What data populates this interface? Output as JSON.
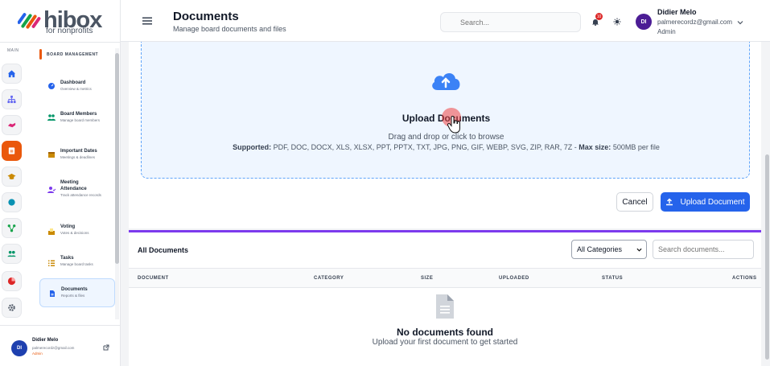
{
  "brand": {
    "name": "hibox",
    "tagline": "for nonprofits"
  },
  "rail": {
    "label": "MAIN",
    "items": [
      {
        "name": "home-icon",
        "color": "#2563eb"
      },
      {
        "name": "org-chart-icon",
        "color": "#6366f1"
      },
      {
        "name": "handshake-icon",
        "color": "#db2777"
      },
      {
        "name": "board-icon",
        "color": "#ffffff",
        "active": true
      },
      {
        "name": "graduation-cap-icon",
        "color": "#ca8a04"
      },
      {
        "name": "circle-icon",
        "color": "#0891b2"
      },
      {
        "name": "network-icon",
        "color": "#16a34a"
      },
      {
        "name": "users-icon",
        "color": "#059669"
      },
      {
        "name": "pie-chart-icon",
        "color": "#dc2626"
      },
      {
        "name": "gear-icon",
        "color": "#4b5563"
      }
    ]
  },
  "menu": {
    "header": "BOARD MANAGEMENT",
    "items": [
      {
        "title": "Dashboard",
        "sub": "Overview & metrics"
      },
      {
        "title": "Board Members",
        "sub": "Manage board members"
      },
      {
        "title": "Important Dates",
        "sub": "Meetings & deadlines"
      },
      {
        "title": "Meeting Attendance",
        "sub": "Track attendance records"
      },
      {
        "title": "Voting",
        "sub": "Votes & decisions"
      },
      {
        "title": "Tasks",
        "sub": "Manage board tasks"
      },
      {
        "title": "Documents",
        "sub": "Reports & files"
      }
    ]
  },
  "footer_user": {
    "initials": "DI",
    "name": "Didier Melo",
    "email": "palmerecordz@gmail.com",
    "role": "Admin"
  },
  "header": {
    "title": "Documents",
    "subtitle": "Manage board documents and files",
    "search_placeholder": "Search...",
    "notification_count": "10",
    "user": {
      "initials": "DI",
      "name": "Didier Melo",
      "email": "palmerecordz@gmail.com",
      "role": "Admin"
    }
  },
  "upload": {
    "title": "Upload Documents",
    "subtitle": "Drag and drop or click to browse",
    "supported_label": "Supported:",
    "supported_types": "PDF, DOC, DOCX, XLS, XLSX, PPT, PPTX, TXT, JPG, PNG, GIF, WEBP, SVG, ZIP, RAR, 7Z -",
    "max_label": "Max size:",
    "max_value": "500MB per file",
    "cancel_label": "Cancel",
    "upload_label": "Upload Document"
  },
  "documents": {
    "title": "All Documents",
    "category_selected": "All Categories",
    "search_placeholder": "Search documents...",
    "columns": [
      "DOCUMENT",
      "CATEGORY",
      "SIZE",
      "UPLOADED",
      "STATUS",
      "ACTIONS"
    ],
    "empty_title": "No documents found",
    "empty_sub": "Upload your first document to get started"
  },
  "colors": {
    "accent": "#2563eb",
    "brand_orange": "#ea580c",
    "divider_purple": "#7c3aed"
  }
}
